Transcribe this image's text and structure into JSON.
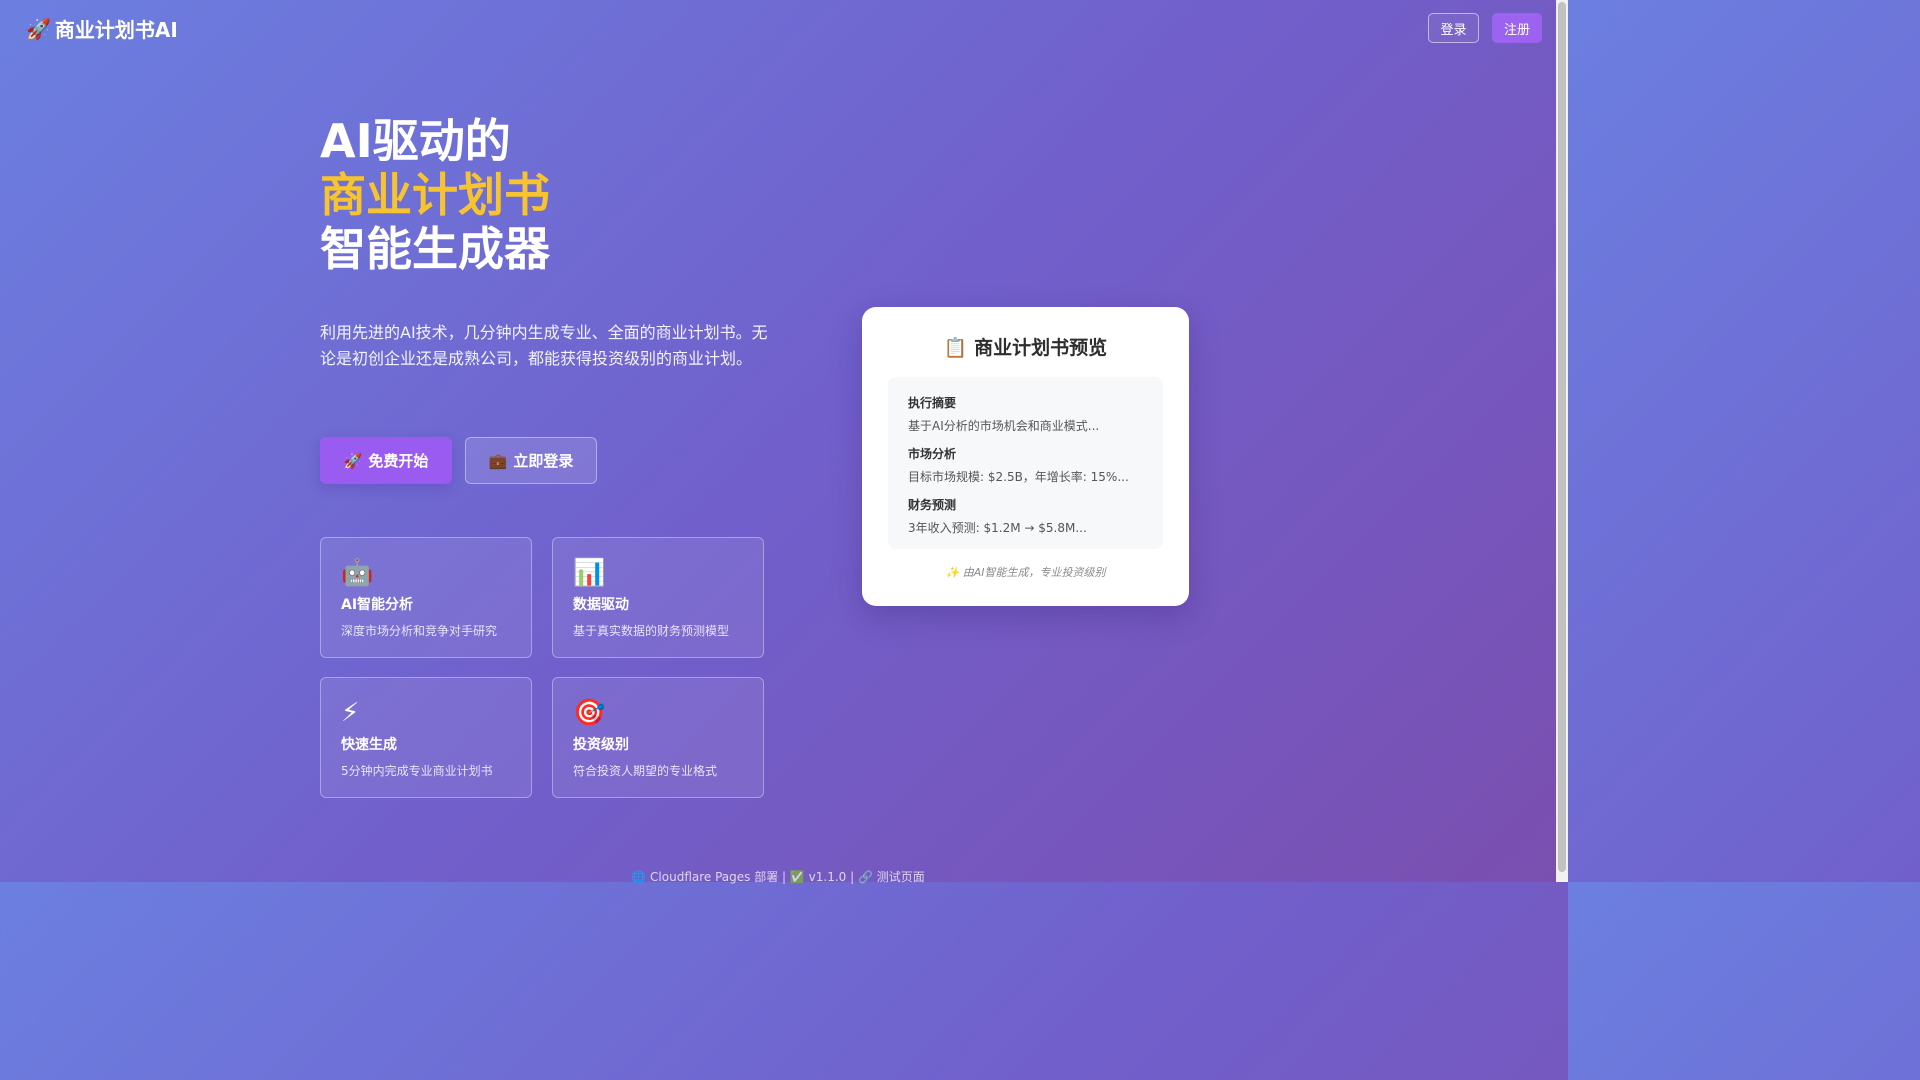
{
  "nav": {
    "brand_icon": "🚀",
    "brand_name": "商业计划书AI",
    "login_label": "登录",
    "register_label": "注册"
  },
  "hero": {
    "title_line1": "AI驱动的",
    "title_line2": "商业计划书",
    "title_line3": "智能生成器",
    "description": "利用先进的AI技术，几分钟内生成专业、全面的商业计划书。无论是初创企业还是成熟公司，都能获得投资级别的商业计划。",
    "start_icon": "🚀",
    "start_label": "免费开始",
    "login_icon": "💼",
    "login_label": "立即登录"
  },
  "features": [
    {
      "icon": "🤖",
      "title": "AI智能分析",
      "desc": "深度市场分析和竞争对手研究"
    },
    {
      "icon": "📊",
      "title": "数据驱动",
      "desc": "基于真实数据的财务预测模型"
    },
    {
      "icon": "⚡",
      "title": "快速生成",
      "desc": "5分钟内完成专业商业计划书"
    },
    {
      "icon": "🎯",
      "title": "投资级别",
      "desc": "符合投资人期望的专业格式"
    }
  ],
  "preview": {
    "icon": "📋",
    "title": "商业计划书预览",
    "sections": [
      {
        "title": "执行摘要",
        "text": "基于AI分析的市场机会和商业模式..."
      },
      {
        "title": "市场分析",
        "text": "目标市场规模: $2.5B，年增长率: 15%..."
      },
      {
        "title": "财务预测",
        "text": "3年收入预测: $1.2M → $5.8M..."
      }
    ],
    "footer": "✨ 由AI智能生成，专业投资级别"
  },
  "footer": {
    "text": "🌐 Cloudflare Pages 部署 | ✅ v1.1.0 | 🔗 测试页面"
  },
  "colors": {
    "accent_yellow": "#f7c32e",
    "primary_purple": "#9a5cf0",
    "gradient_start": "#6c7fe0",
    "gradient_end": "#7a4fb0"
  }
}
